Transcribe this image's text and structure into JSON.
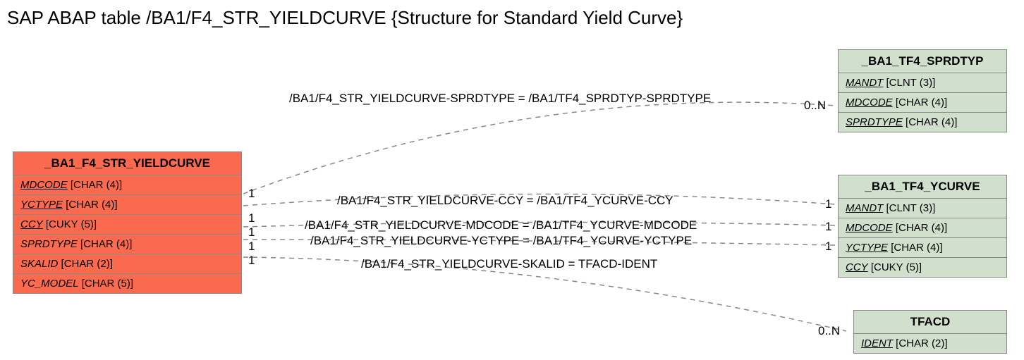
{
  "title": "SAP ABAP table /BA1/F4_STR_YIELDCURVE {Structure for Standard Yield Curve}",
  "entities": {
    "main": {
      "name": "_BA1_F4_STR_YIELDCURVE",
      "fields": [
        {
          "key": "MDCODE",
          "type": "[CHAR (4)]",
          "iskey": true
        },
        {
          "key": "YCTYPE",
          "type": "[CHAR (4)]",
          "iskey": true
        },
        {
          "key": "CCY",
          "type": "[CUKY (5)]",
          "iskey": true
        },
        {
          "key": "SPRDTYPE",
          "type": "[CHAR (4)]",
          "iskey": false
        },
        {
          "key": "SKALID",
          "type": "[CHAR (2)]",
          "iskey": false
        },
        {
          "key": "YC_MODEL",
          "type": "[CHAR (5)]",
          "iskey": false
        }
      ]
    },
    "sprdtyp": {
      "name": "_BA1_TF4_SPRDTYP",
      "fields": [
        {
          "key": "MANDT",
          "type": "[CLNT (3)]",
          "iskey": true
        },
        {
          "key": "MDCODE",
          "type": "[CHAR (4)]",
          "iskey": true
        },
        {
          "key": "SPRDTYPE",
          "type": "[CHAR (4)]",
          "iskey": true
        }
      ]
    },
    "ycurve": {
      "name": "_BA1_TF4_YCURVE",
      "fields": [
        {
          "key": "MANDT",
          "type": "[CLNT (3)]",
          "iskey": true
        },
        {
          "key": "MDCODE",
          "type": "[CHAR (4)]",
          "iskey": true
        },
        {
          "key": "YCTYPE",
          "type": "[CHAR (4)]",
          "iskey": true
        },
        {
          "key": "CCY",
          "type": "[CUKY (5)]",
          "iskey": true
        }
      ]
    },
    "tfacd": {
      "name": "TFACD",
      "fields": [
        {
          "key": "IDENT",
          "type": "[CHAR (2)]",
          "iskey": true
        }
      ]
    }
  },
  "relations": {
    "r1": "/BA1/F4_STR_YIELDCURVE-SPRDTYPE = /BA1/TF4_SPRDTYP-SPRDTYPE",
    "r2": "/BA1/F4_STR_YIELDCURVE-CCY = /BA1/TF4_YCURVE-CCY",
    "r3": "/BA1/F4_STR_YIELDCURVE-MDCODE = /BA1/TF4_YCURVE-MDCODE",
    "r4": "/BA1/F4_STR_YIELDCURVE-YCTYPE = /BA1/TF4_YCURVE-YCTYPE",
    "r5": "/BA1/F4_STR_YIELDCURVE-SKALID = TFACD-IDENT"
  },
  "cards": {
    "c1l": "1",
    "c1r": "0..N",
    "c2l": "1",
    "c2r": "1",
    "c3l": "1",
    "c3r": "1",
    "c4l": "1",
    "c4r": "1",
    "c5l": "1",
    "c5r": "0..N"
  }
}
